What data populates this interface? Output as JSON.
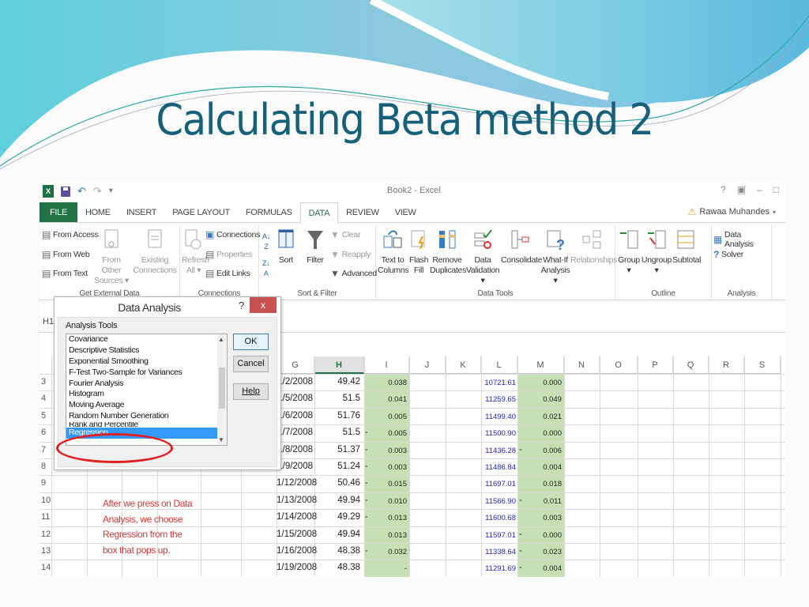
{
  "slide": {
    "title": "Calculating Beta method 2",
    "accent_color": "#17607a"
  },
  "excel": {
    "window_title": "Book2 - Excel",
    "qat": {
      "logo": "X",
      "undo_icon": "↶",
      "redo_icon": "↷",
      "more_icon": "▾"
    },
    "window_controls": {
      "help": "?",
      "ribbon_display": "▣",
      "minimize": "–",
      "restore": "□"
    },
    "tabs": [
      {
        "label": "FILE"
      },
      {
        "label": "HOME"
      },
      {
        "label": "INSERT"
      },
      {
        "label": "PAGE LAYOUT"
      },
      {
        "label": "FORMULAS"
      },
      {
        "label": "DATA"
      },
      {
        "label": "REVIEW"
      },
      {
        "label": "VIEW"
      }
    ],
    "active_tab": "DATA",
    "user_name": "Rawaa Muhandes",
    "ribbon": {
      "get_external_data": {
        "label": "Get External Data",
        "from_access": "From Access",
        "from_web": "From Web",
        "from_text": "From Text",
        "from_other_1": "From Other",
        "from_other_2": "Sources",
        "existing_1": "Existing",
        "existing_2": "Connections"
      },
      "connections": {
        "label": "Connections",
        "refresh_1": "Refresh",
        "refresh_2": "All",
        "connections": "Connections",
        "properties": "Properties",
        "edit_links": "Edit Links"
      },
      "sort_filter": {
        "label": "Sort & Filter",
        "sort": "Sort",
        "filter": "Filter",
        "clear": "Clear",
        "reapply": "Reapply",
        "advanced": "Advanced"
      },
      "data_tools": {
        "label": "Data Tools",
        "text_to_1": "Text to",
        "text_to_2": "Columns",
        "flash_1": "Flash",
        "flash_2": "Fill",
        "remove_1": "Remove",
        "remove_2": "Duplicates",
        "validation_1": "Data",
        "validation_2": "Validation",
        "consolidate": "Consolidate",
        "whatif_1": "What-If",
        "whatif_2": "Analysis",
        "relationships": "Relationships"
      },
      "outline": {
        "label": "Outline",
        "group": "Group",
        "ungroup": "Ungroup",
        "subtotal": "Subtotal"
      },
      "analysis": {
        "label": "Analysis",
        "data_analysis": "Data Analysis",
        "solver": "Solver"
      }
    },
    "name_box": "H1",
    "columns": [
      "G",
      "H",
      "I",
      "J",
      "K",
      "L",
      "M",
      "N",
      "O",
      "P",
      "Q",
      "R",
      "S"
    ],
    "selected_column": "H",
    "row_numbers": [
      "3",
      "4",
      "5",
      "6",
      "7",
      "8",
      "9",
      "10",
      "11",
      "12",
      "13",
      "14"
    ],
    "rows": [
      {
        "date": "1/2/2008",
        "h": "49.42",
        "h_neg": "",
        "i": "0.038",
        "l": "10721.61",
        "l_neg": "",
        "m": "0.000"
      },
      {
        "date": "1/5/2008",
        "h": "51.5",
        "h_neg": "",
        "i": "0.041",
        "l": "11259.65",
        "l_neg": "",
        "m": "0.049"
      },
      {
        "date": "1/6/2008",
        "h": "51.76",
        "h_neg": "",
        "i": "0.005",
        "l": "11499.40",
        "l_neg": "",
        "m": "0.021"
      },
      {
        "date": "1/7/2008",
        "h": "51.5",
        "h_neg": "-",
        "i": "0.005",
        "l": "11500.90",
        "l_neg": "",
        "m": "0.000"
      },
      {
        "date": "1/8/2008",
        "h": "51.37",
        "h_neg": "-",
        "i": "0.003",
        "l": "11436.28",
        "l_neg": "-",
        "m": "0.006"
      },
      {
        "date": "1/9/2008",
        "h": "51.24",
        "h_neg": "-",
        "i": "0.003",
        "l": "11486.84",
        "l_neg": "",
        "m": "0.004"
      },
      {
        "date": "1/12/2008",
        "h": "50.46",
        "h_neg": "-",
        "i": "0.015",
        "l": "11697.01",
        "l_neg": "",
        "m": "0.018"
      },
      {
        "date": "1/13/2008",
        "h": "49.94",
        "h_neg": "-",
        "i": "0.010",
        "l": "11566.90",
        "l_neg": "-",
        "m": "0.011"
      },
      {
        "date": "1/14/2008",
        "h": "49.29",
        "h_neg": "-",
        "i": "0.013",
        "l": "11600.68",
        "l_neg": "",
        "m": "0.003"
      },
      {
        "date": "1/15/2008",
        "h": "49.94",
        "h_neg": "",
        "i": "0.013",
        "l": "11597.01",
        "l_neg": "-",
        "m": "0.000"
      },
      {
        "date": "1/16/2008",
        "h": "48.38",
        "h_neg": "-",
        "i": "0.032",
        "l": "11338.64",
        "l_neg": "-",
        "m": "0.023"
      },
      {
        "date": "1/19/2008",
        "h": "48.38",
        "h_neg": "",
        "i": "-",
        "l": "11291.69",
        "l_neg": "-",
        "m": "0.004"
      }
    ],
    "note_lines": [
      "After we press on Data",
      "Analysis, we choose",
      "Regression from the",
      "box that pops up."
    ],
    "dialog": {
      "title": "Data Analysis",
      "help_icon": "?",
      "close_icon": "x",
      "list_label": "Analysis Tools",
      "items": [
        "Covariance",
        "Descriptive Statistics",
        "Exponential Smoothing",
        "F-Test Two-Sample for Variances",
        "Fourier Analysis",
        "Histogram",
        "Moving Average",
        "Random Number Generation",
        "Rank and Percentile",
        "Regression"
      ],
      "selected_item": "Regression",
      "ok_label": "OK",
      "cancel_label": "Cancel",
      "help_label": "Help",
      "highlight_color": "#e02020"
    }
  }
}
